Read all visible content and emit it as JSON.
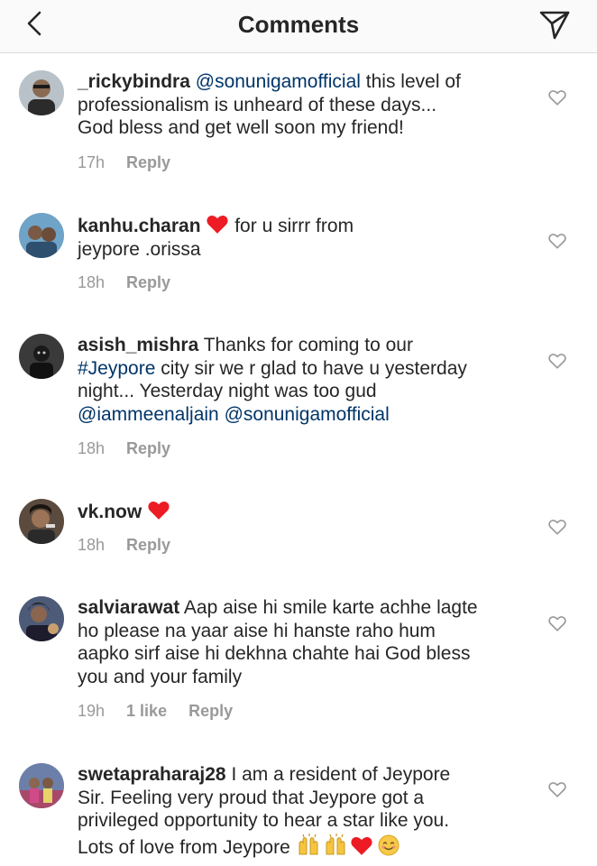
{
  "header": {
    "title": "Comments",
    "back_icon": "chevron-left-icon",
    "send_icon": "paper-plane-icon"
  },
  "colors": {
    "heart_red": "#ed1c24",
    "mention_blue": "#003569",
    "meta_gray": "#999999"
  },
  "comments": [
    {
      "username": "_rickybindra",
      "mention": "@sonunigamofficial",
      "text_line1_rest": " this level of",
      "text_line2": "professionalism is unheard of these days...",
      "text_line3": "God bless and get well soon my friend!",
      "time": "17h",
      "reply": "Reply"
    },
    {
      "username": "kanhu.charan",
      "text_after_emoji": " for u sirrr from",
      "text_line2": "jeypore .orissa",
      "time": "18h",
      "reply": "Reply"
    },
    {
      "username": "asish_mishra",
      "text_line1_rest": " Thanks for coming to our",
      "hashtag": "#Jeypore",
      "text_line2_rest": " city sir we r glad to have u yesterday",
      "text_line3": "night... Yesterday night was too gud",
      "mention1": "@iammeenaljain",
      "mention2": "@sonunigamofficial",
      "time": "18h",
      "reply": "Reply"
    },
    {
      "username": "vk.now",
      "time": "18h",
      "reply": "Reply"
    },
    {
      "username": "salviarawat",
      "text_line1_rest": " Aap aise hi smile karte achhe lagte",
      "text_line2": "ho please na yaar aise hi hanste raho hum",
      "text_line3": "aapko sirf aise hi dekhna chahte hai God bless",
      "text_line4": "you and your family",
      "time": "19h",
      "likes": "1 like",
      "reply": "Reply"
    },
    {
      "username": "swetapraharaj28",
      "text_line1_rest": " I am a resident of Jeypore",
      "text_line2": "Sir. Feeling very proud that Jeypore got a",
      "text_line3": "privileged opportunity to hear a star like you.",
      "text_line4": "Lots of love from Jeypore"
    }
  ]
}
